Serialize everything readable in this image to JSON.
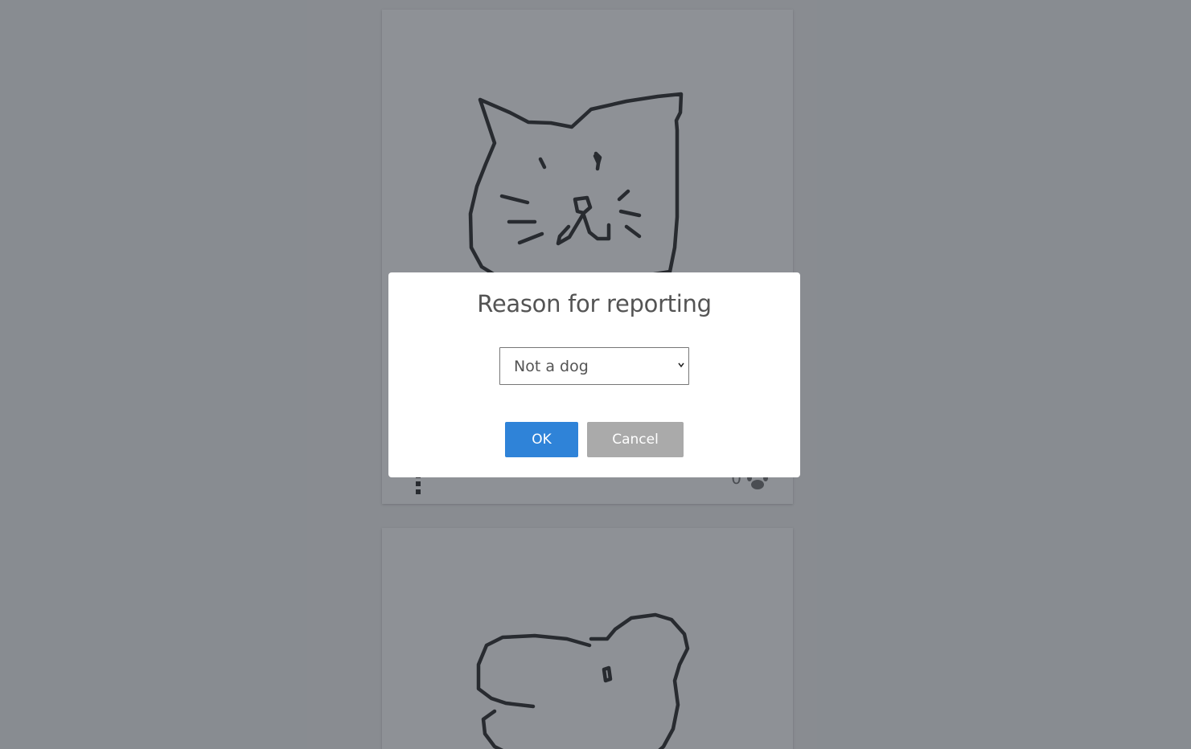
{
  "feed": {
    "cards": [
      {
        "drawing": "cat-face-drawing",
        "like_count": "0",
        "like_icon": "paw-icon",
        "menu_icon": "vertical-dots-icon"
      },
      {
        "drawing": "animal-head-drawing"
      }
    ]
  },
  "dialog": {
    "title": "Reason for reporting",
    "reason_select": {
      "selected": "Not a dog",
      "options": [
        "Not a dog"
      ]
    },
    "ok_label": "OK",
    "cancel_label": "Cancel"
  },
  "colors": {
    "backdrop": "#84878c",
    "card": "#9a9a9a",
    "ok_button": "#2f83d8",
    "cancel_button": "#aaaaaa"
  }
}
